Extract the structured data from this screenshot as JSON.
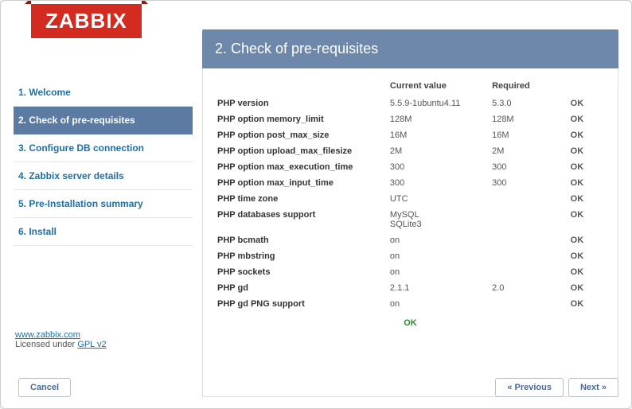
{
  "logo": "ZABBIX",
  "header": {
    "title": "2. Check of pre-requisites"
  },
  "sidebar": {
    "steps": [
      {
        "label": "1. Welcome"
      },
      {
        "label": "2. Check of pre-requisites"
      },
      {
        "label": "3. Configure DB connection"
      },
      {
        "label": "4. Zabbix server details"
      },
      {
        "label": "5. Pre-Installation summary"
      },
      {
        "label": "6. Install"
      }
    ],
    "current_index": 1,
    "link_label": "www.zabbix.com",
    "license_prefix": "Licensed under ",
    "license_link": "GPL v2"
  },
  "table": {
    "columns": {
      "name": "",
      "current": "Current value",
      "required": "Required",
      "status": ""
    },
    "rows": [
      {
        "name": "PHP version",
        "current": "5.5.9-1ubuntu4.11",
        "required": "5.3.0",
        "status": "OK"
      },
      {
        "name": "PHP option memory_limit",
        "current": "128M",
        "required": "128M",
        "status": "OK"
      },
      {
        "name": "PHP option post_max_size",
        "current": "16M",
        "required": "16M",
        "status": "OK"
      },
      {
        "name": "PHP option upload_max_filesize",
        "current": "2M",
        "required": "2M",
        "status": "OK"
      },
      {
        "name": "PHP option max_execution_time",
        "current": "300",
        "required": "300",
        "status": "OK"
      },
      {
        "name": "PHP option max_input_time",
        "current": "300",
        "required": "300",
        "status": "OK"
      },
      {
        "name": "PHP time zone",
        "current": "UTC",
        "required": "",
        "status": "OK"
      },
      {
        "name": "PHP databases support",
        "current": "MySQL\nSQLite3",
        "required": "",
        "status": "OK"
      },
      {
        "name": "PHP bcmath",
        "current": "on",
        "required": "",
        "status": "OK"
      },
      {
        "name": "PHP mbstring",
        "current": "on",
        "required": "",
        "status": "OK"
      },
      {
        "name": "PHP sockets",
        "current": "on",
        "required": "",
        "status": "OK"
      },
      {
        "name": "PHP gd",
        "current": "2.1.1",
        "required": "2.0",
        "status": "OK"
      },
      {
        "name": "PHP gd PNG support",
        "current": "on",
        "required": "",
        "status": "OK"
      }
    ],
    "overall": "OK"
  },
  "buttons": {
    "cancel": "Cancel",
    "previous": "« Previous",
    "next": "Next »"
  }
}
